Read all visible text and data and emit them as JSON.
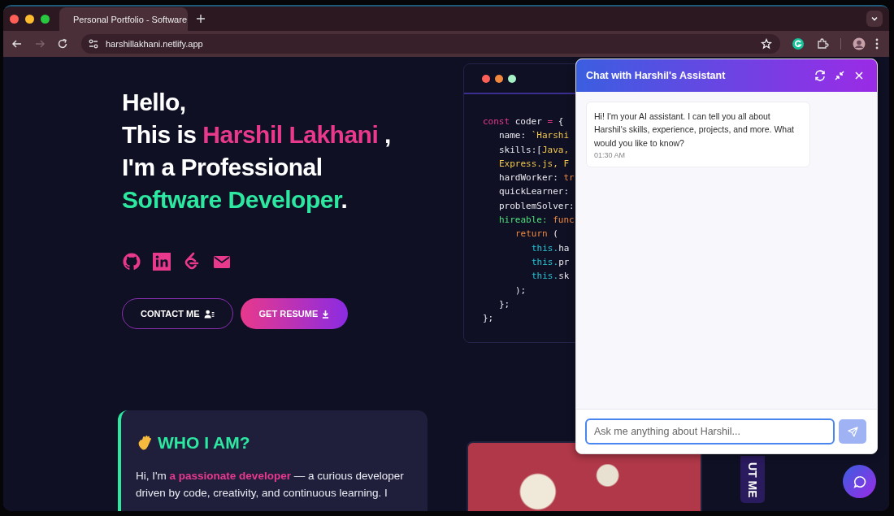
{
  "browser": {
    "tab": {
      "title": "Personal Portfolio - Software",
      "selected": true
    },
    "url": "harshillakhani.netlify.app",
    "forward_disabled": true
  },
  "hero": {
    "heading_lines": [
      {
        "segments": [
          {
            "text": "Hello,",
            "kind": "plain"
          }
        ]
      },
      {
        "segments": [
          {
            "text": "This is ",
            "kind": "plain"
          },
          {
            "text": "Harshil Lakhani",
            "kind": "accent"
          },
          {
            "text": " ,",
            "kind": "plain"
          }
        ]
      },
      {
        "segments": [
          {
            "text": "I'm a Professional",
            "kind": "plain"
          }
        ]
      },
      {
        "segments": [
          {
            "text": "Software Developer",
            "kind": "highlight"
          },
          {
            "text": ".",
            "kind": "plain"
          }
        ]
      }
    ],
    "social": [
      {
        "kind": "github"
      },
      {
        "kind": "linkedin"
      },
      {
        "kind": "leetcode"
      },
      {
        "kind": "mail"
      }
    ],
    "buttons": [
      {
        "label": "CONTACT ME",
        "kind": "outline"
      },
      {
        "label": "GET RESUME",
        "kind": "filled"
      }
    ]
  },
  "code": {
    "lines": [
      {
        "tokens": [
          {
            "text": "const",
            "kind": "keyword"
          },
          {
            "text": " coder ",
            "kind": "plain"
          },
          {
            "text": "=",
            "kind": "keyword"
          },
          {
            "text": " {",
            "kind": "plain"
          }
        ],
        "children": [
          {
            "tokens": [
              {
                "text": "name: ",
                "kind": "plain"
              },
              {
                "text": "`Harshi",
                "kind": "string"
              }
            ]
          },
          {
            "tokens": [
              {
                "text": "skills:[",
                "kind": "plain"
              },
              {
                "text": "Java,",
                "kind": "string"
              }
            ]
          },
          {
            "tokens": [
              {
                "text": "Express.js, F",
                "kind": "string"
              }
            ]
          },
          {
            "tokens": [
              {
                "text": "hardWorker: ",
                "kind": "plain"
              },
              {
                "text": "tr",
                "kind": "value"
              }
            ]
          },
          {
            "tokens": [
              {
                "text": "quickLearner:",
                "kind": "plain"
              }
            ]
          },
          {
            "tokens": [
              {
                "text": "problemSolver:",
                "kind": "plain"
              }
            ]
          },
          {
            "tokens": [
              {
                "text": "hireable: ",
                "kind": "prop"
              },
              {
                "text": "func",
                "kind": "value"
              }
            ],
            "children": [
              {
                "tokens": [
                  {
                    "text": "return",
                    "kind": "value"
                  },
                  {
                    "text": " (",
                    "kind": "plain"
                  }
                ],
                "children": [
                  {
                    "tokens": [
                      {
                        "text": "this.",
                        "kind": "self"
                      },
                      {
                        "text": "ha",
                        "kind": "plain"
                      }
                    ]
                  },
                  {
                    "tokens": [
                      {
                        "text": "this.",
                        "kind": "self"
                      },
                      {
                        "text": "pr",
                        "kind": "plain"
                      }
                    ]
                  },
                  {
                    "tokens": [
                      {
                        "text": "this.",
                        "kind": "self"
                      },
                      {
                        "text": "sk",
                        "kind": "plain"
                      }
                    ]
                  }
                ]
              },
              {
                "tokens": [
                  {
                    "text": ");",
                    "kind": "plain"
                  }
                ]
              }
            ]
          },
          {
            "tokens": [
              {
                "text": "};",
                "kind": "plain"
              }
            ]
          }
        ]
      },
      {
        "tokens": [
          {
            "text": "};",
            "kind": "plain"
          }
        ]
      }
    ]
  },
  "about": {
    "title": "WHO I AM?",
    "text": "Hi, I'm **a passionate developer** — a curious developer driven by code, creativity, and continuous learning. I",
    "side_tab": "UT ME"
  },
  "chat": {
    "title": "Chat with Harshil's Assistant",
    "messages": [
      {
        "text": "Hi! I'm your AI assistant. I can tell you all about Harshil's skills, experience, projects, and more. What would you like to know?",
        "time": "01:30 AM"
      }
    ],
    "input": {
      "placeholder": "Ask me anything about Harshil..."
    },
    "send_disabled": true
  }
}
